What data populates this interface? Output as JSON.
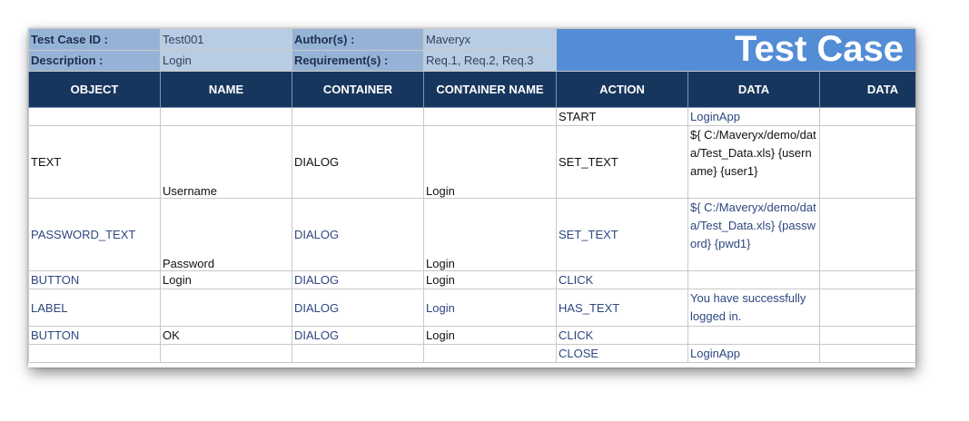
{
  "meta": {
    "test_case_id_label": "Test Case ID :",
    "test_case_id": "Test001",
    "author_label": "Author(s) :",
    "author": "Maveryx",
    "description_label": "Description :",
    "description": "Login",
    "requirement_label": "Requirement(s) :",
    "requirement": "Req.1, Req.2, Req.3",
    "title": "Test Case"
  },
  "headers": [
    "OBJECT",
    "NAME",
    "CONTAINER",
    "CONTAINER NAME",
    "ACTION",
    "DATA",
    "DATA"
  ],
  "rows": [
    {
      "object": "",
      "name": "",
      "container": "",
      "container_name": "",
      "action": "START",
      "data": "LoginApp"
    },
    {
      "object": "TEXT",
      "name": "Username",
      "container": "DIALOG",
      "container_name": "Login",
      "action": "SET_TEXT",
      "data": "${ C:/Maveryx/demo/data/Test_Data.xls} {username} {user1}"
    },
    {
      "object": "PASSWORD_TEXT",
      "name": "Password",
      "container": "DIALOG",
      "container_name": "Login",
      "action": "SET_TEXT",
      "data": "${ C:/Maveryx/demo/data/Test_Data.xls} {password} {pwd1}"
    },
    {
      "object": "BUTTON",
      "name": "Login",
      "container": "DIALOG",
      "container_name": "Login",
      "action": "CLICK",
      "data": ""
    },
    {
      "object": "LABEL",
      "name": "",
      "container": "DIALOG",
      "container_name": "Login",
      "action": "HAS_TEXT",
      "data": "You have successfully logged in."
    },
    {
      "object": "BUTTON",
      "name": "OK",
      "container": "DIALOG",
      "container_name": "Login",
      "action": "CLICK",
      "data": ""
    },
    {
      "object": "",
      "name": "",
      "container": "",
      "container_name": "",
      "action": "CLOSE",
      "data": "LoginApp"
    }
  ],
  "colors": {
    "header_bg": "#17365d",
    "title_bg": "#538dd5",
    "meta_label_bg": "#95b3d7",
    "meta_value_bg": "#b8cce4"
  }
}
